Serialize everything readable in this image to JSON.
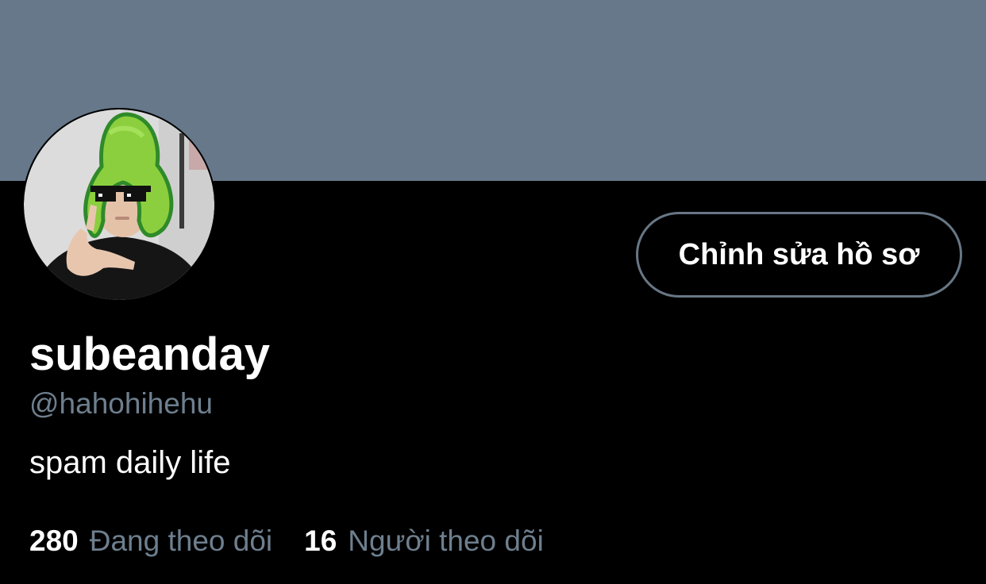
{
  "colors": {
    "banner": "#66788a",
    "background": "#000000",
    "text_primary": "#ffffff",
    "text_secondary": "#6e7f8e",
    "button_border": "#687785"
  },
  "profile": {
    "display_name": "subeanday",
    "handle": "@hahohihehu",
    "bio": "spam daily life",
    "avatar_icon": "avatar-person-avocado-hat"
  },
  "actions": {
    "edit_profile_label": "Chỉnh sửa hồ sơ"
  },
  "stats": {
    "following_count": "280",
    "following_label": "Đang theo dõi",
    "followers_count": "16",
    "followers_label": "Người theo dõi"
  }
}
